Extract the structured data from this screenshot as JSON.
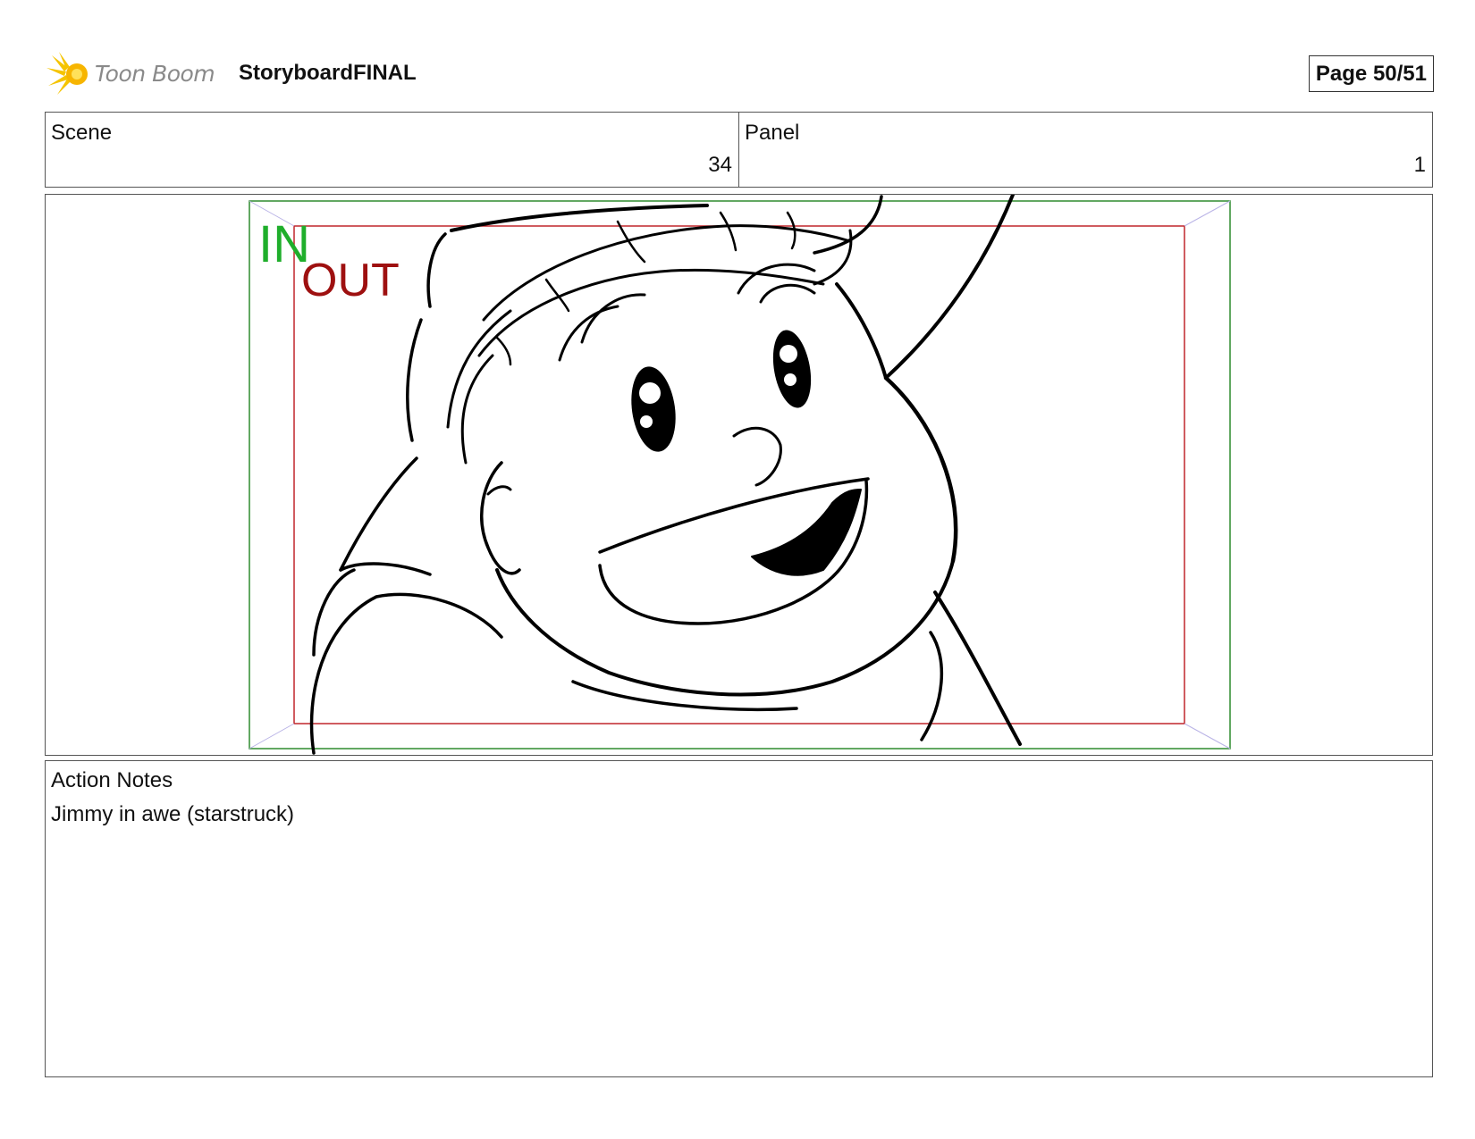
{
  "header": {
    "logo_text": "Toon Boom",
    "doc_title": "StoryboardFINAL",
    "page_label": "Page 50/51"
  },
  "info": {
    "scene_label": "Scene",
    "scene_value": "34",
    "panel_label": "Panel",
    "panel_value": "1"
  },
  "panel": {
    "in_label": "IN",
    "out_label": "OUT",
    "in_frame_color": "#2e8b2e",
    "out_frame_color": "#c0262b"
  },
  "notes": {
    "label": "Action Notes",
    "text": "Jimmy in awe (starstruck)"
  }
}
